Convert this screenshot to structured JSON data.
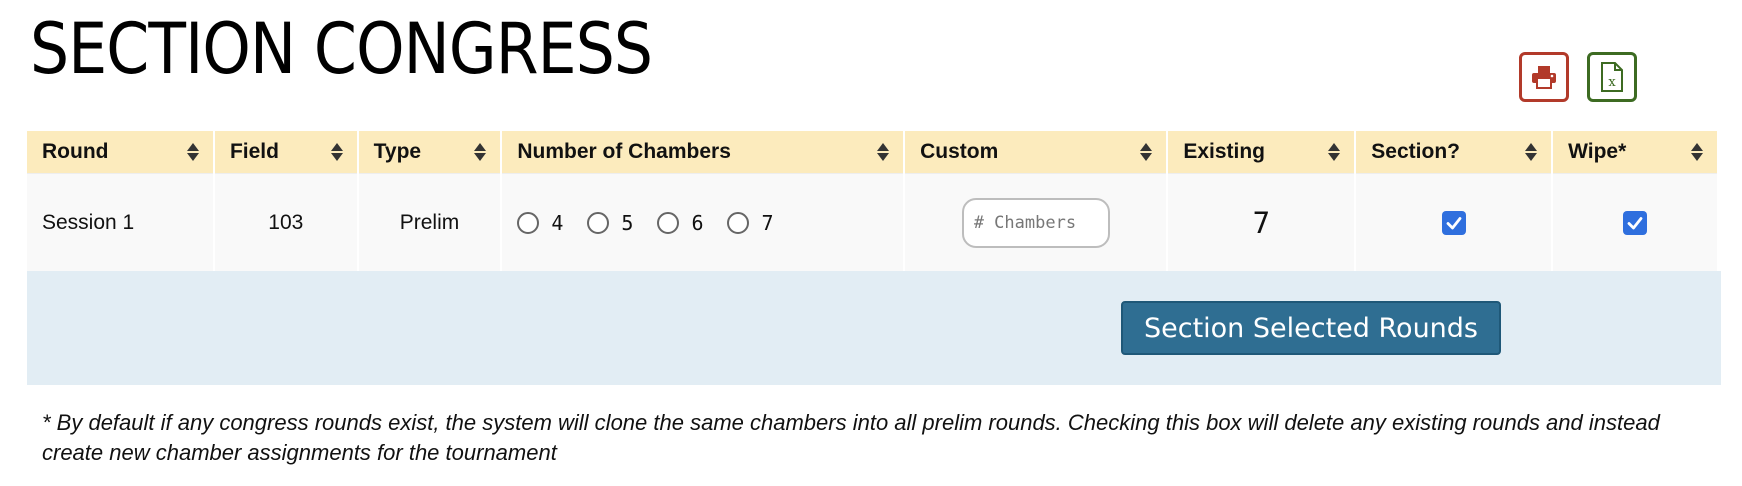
{
  "page": {
    "title": "SECTION CONGRESS"
  },
  "toolbar": {
    "print_icon": "printer-icon",
    "excel_icon": "excel-file-icon",
    "print_color": "#b23a2a",
    "excel_color": "#3d6b22"
  },
  "table": {
    "headers": [
      "Round",
      "Field",
      "Type",
      "Number of Chambers",
      "Custom",
      "Existing",
      "Section?",
      "Wipe*"
    ],
    "header_bg": "#fcebbd",
    "rows": [
      {
        "round": "Session 1",
        "field": "103",
        "type": "Prelim",
        "chamber_options": [
          "4",
          "5",
          "6",
          "7"
        ],
        "custom_placeholder": "# Chambers",
        "custom_value": "",
        "existing": "7",
        "section_checked": true,
        "wipe_checked": true
      }
    ]
  },
  "actions": {
    "section_button_label": "Section Selected Rounds",
    "button_color": "#2f6e92",
    "bar_color": "#e2edf4"
  },
  "footnote": "* By default if any congress rounds exist, the system will clone the same chambers into all prelim rounds. Checking this box will delete any existing rounds and instead create new chamber assignments for the tournament"
}
